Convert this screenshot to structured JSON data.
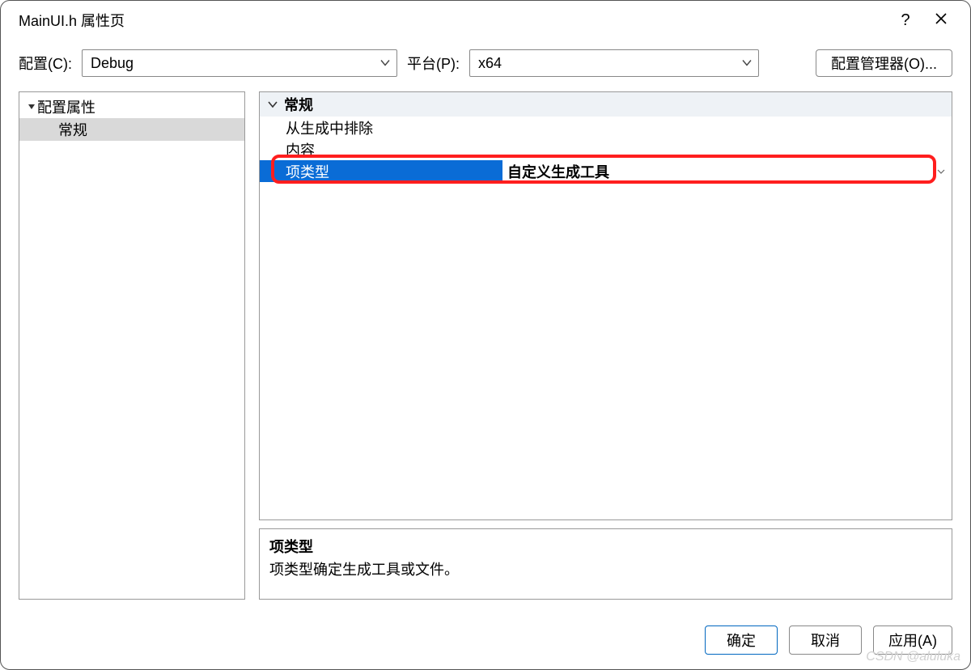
{
  "window": {
    "title": "MainUI.h 属性页"
  },
  "toolbar": {
    "config_label": "配置(C):",
    "config_value": "Debug",
    "platform_label": "平台(P):",
    "platform_value": "x64",
    "config_mgr": "配置管理器(O)..."
  },
  "tree": {
    "root": "配置属性",
    "child_general": "常规"
  },
  "propgrid": {
    "group": "常规",
    "rows": [
      {
        "key": "从生成中排除",
        "value": ""
      },
      {
        "key": "内容",
        "value": ""
      },
      {
        "key": "项类型",
        "value": "自定义生成工具"
      }
    ],
    "selected_index": 2
  },
  "description": {
    "title": "项类型",
    "text": "项类型确定生成工具或文件。"
  },
  "footer": {
    "ok": "确定",
    "cancel": "取消",
    "apply": "应用(A)"
  },
  "watermark": "CSDN @aluluka"
}
